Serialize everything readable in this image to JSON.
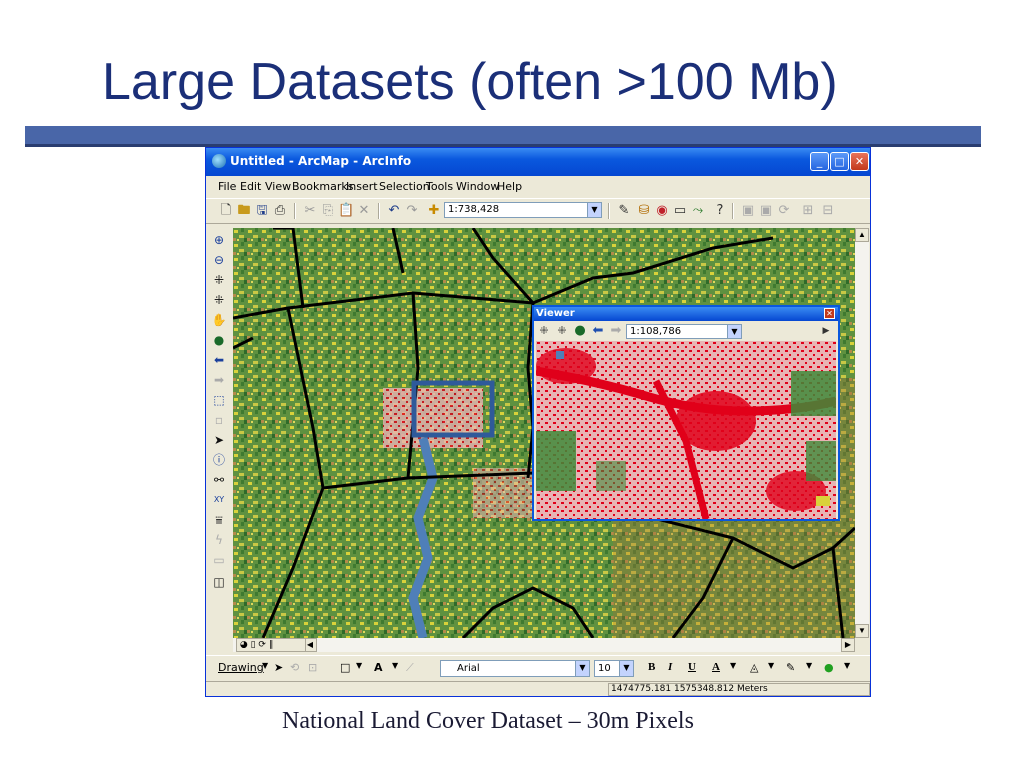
{
  "slide": {
    "title": "Large Datasets (often >100 Mb)",
    "caption": "National Land Cover Dataset – 30m Pixels"
  },
  "window": {
    "title": "Untitled - ArcMap - ArcInfo",
    "controls": {
      "minimize": "_",
      "maximize": "□",
      "close": "✕"
    }
  },
  "menu": [
    "File",
    "Edit",
    "View",
    "Bookmarks",
    "Insert",
    "Selection",
    "Tools",
    "Window",
    "Help"
  ],
  "toolbar": {
    "scale": "1:738,428"
  },
  "viewer": {
    "title": "Viewer",
    "scale": "1:108,786"
  },
  "drawing_toolbar": {
    "label": "Drawing",
    "font": "Arial",
    "font_size": "10",
    "bold": "B",
    "italic": "I",
    "underline": "U",
    "font_color_label": "A"
  },
  "status": {
    "coordinates": "1474775.181  1575348.812 Meters"
  },
  "colors": {
    "title_text": "#1b2f78",
    "title_rule": "#4966a8",
    "window_titlebar": "#0a58de",
    "urban_red": "#e0001a",
    "forest_green": "#3f8a3a",
    "agri_yellow": "#d9d23a",
    "water_blue": "#4f7fb8",
    "zoom_box": "#2f5a9a"
  }
}
